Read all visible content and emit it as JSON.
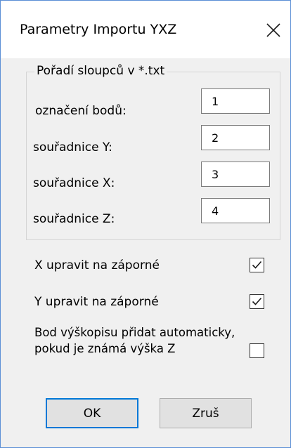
{
  "window": {
    "title": "Parametry Importu YXZ",
    "close_icon": "close-icon",
    "accent_color": "#0078d7"
  },
  "column_order": {
    "legend": "Pořadí sloupců v *.txt",
    "fields": [
      {
        "label": "označení bodů:",
        "value": "1"
      },
      {
        "label": "souřadnice Y:",
        "value": "2"
      },
      {
        "label": "souřadnice X:",
        "value": "3"
      },
      {
        "label": "souřadnice Z:",
        "value": "4"
      }
    ]
  },
  "options": [
    {
      "label": "X upravit na záporné",
      "checked": true
    },
    {
      "label": "Y upravit na záporné",
      "checked": true
    },
    {
      "label": "Bod výškopisu přidat automaticky, pokud je známá výška Z",
      "checked": false
    }
  ],
  "buttons": {
    "ok_label": "OK",
    "cancel_label": "Zruš"
  }
}
